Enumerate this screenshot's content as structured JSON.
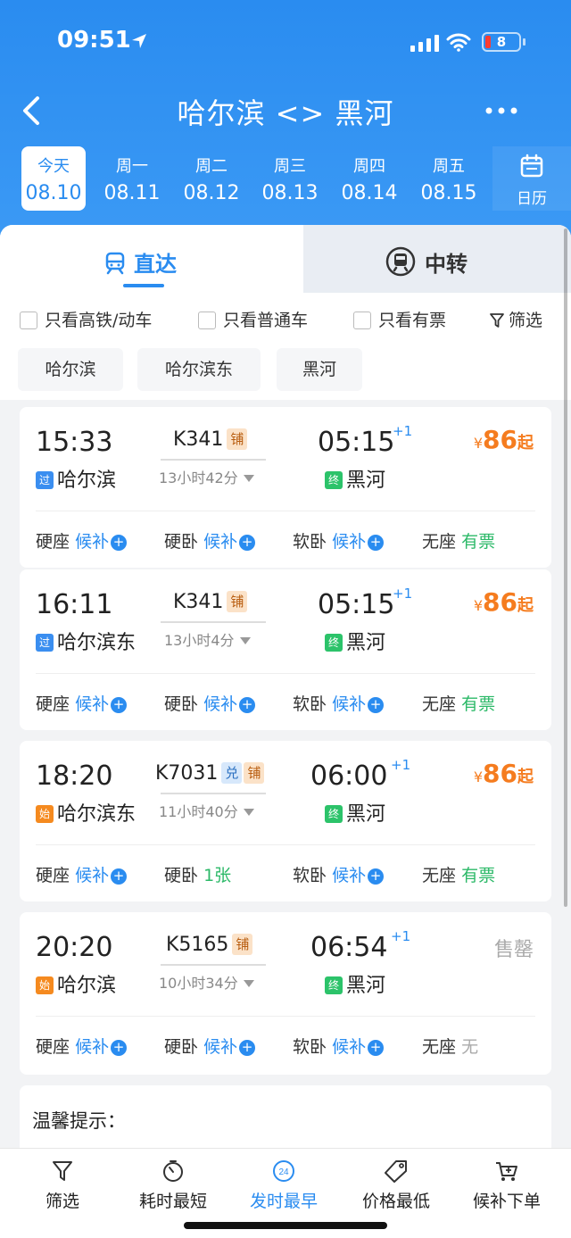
{
  "status": {
    "time": "09:51",
    "battery": "8"
  },
  "nav": {
    "title": "哈尔滨 <> 黑河"
  },
  "dates": [
    {
      "weekday": "今天",
      "date": "08.10",
      "active": true
    },
    {
      "weekday": "周一",
      "date": "08.11"
    },
    {
      "weekday": "周二",
      "date": "08.12"
    },
    {
      "weekday": "周三",
      "date": "08.13"
    },
    {
      "weekday": "周四",
      "date": "08.14"
    },
    {
      "weekday": "周五",
      "date": "08.15"
    }
  ],
  "calendar_label": "日历",
  "tabs": {
    "direct": "直达",
    "transfer": "中转"
  },
  "filters": {
    "high_speed": "只看高铁/动车",
    "normal": "只看普通车",
    "available": "只看有票",
    "filter": "筛选"
  },
  "stations": [
    "哈尔滨",
    "哈尔滨东",
    "黑河"
  ],
  "trains": [
    {
      "dep_time": "15:33",
      "dep_station": "哈尔滨",
      "dep_tag": "过",
      "number": "K341",
      "badges": [
        "铺"
      ],
      "duration": "13小时42分",
      "arr_time": "05:15",
      "arr_plus": "+1",
      "arr_station": "黑河",
      "arr_tag": "终",
      "price_symbol": "¥",
      "price": "86",
      "price_suffix": "起",
      "seats": [
        {
          "name": "硬座",
          "status": "候补"
        },
        {
          "name": "硬卧",
          "status": "候补"
        },
        {
          "name": "软卧",
          "status": "候补"
        },
        {
          "name": "无座",
          "status": "有票"
        }
      ]
    },
    {
      "dep_time": "16:11",
      "dep_station": "哈尔滨东",
      "dep_tag": "过",
      "number": "K341",
      "badges": [
        "铺"
      ],
      "duration": "13小时4分",
      "arr_time": "05:15",
      "arr_plus": "+1",
      "arr_station": "黑河",
      "arr_tag": "终",
      "price_symbol": "¥",
      "price": "86",
      "price_suffix": "起",
      "seats": [
        {
          "name": "硬座",
          "status": "候补"
        },
        {
          "name": "硬卧",
          "status": "候补"
        },
        {
          "name": "软卧",
          "status": "候补"
        },
        {
          "name": "无座",
          "status": "有票"
        }
      ]
    },
    {
      "dep_time": "18:20",
      "dep_station": "哈尔滨东",
      "dep_tag": "始",
      "number": "K7031",
      "badges": [
        "兑",
        "铺"
      ],
      "duration": "11小时40分",
      "arr_time": "06:00",
      "arr_plus": "+1",
      "arr_station": "黑河",
      "arr_tag": "终",
      "price_symbol": "¥",
      "price": "86",
      "price_suffix": "起",
      "seats": [
        {
          "name": "硬座",
          "status": "候补"
        },
        {
          "name": "硬卧",
          "status": "1张"
        },
        {
          "name": "软卧",
          "status": "候补"
        },
        {
          "name": "无座",
          "status": "有票"
        }
      ]
    },
    {
      "dep_time": "20:20",
      "dep_station": "哈尔滨",
      "dep_tag": "始",
      "number": "K5165",
      "badges": [
        "铺"
      ],
      "duration": "10小时34分",
      "arr_time": "06:54",
      "arr_plus": "+1",
      "arr_station": "黑河",
      "arr_tag": "终",
      "soldout": "售罄",
      "seats": [
        {
          "name": "硬座",
          "status": "候补"
        },
        {
          "name": "硬卧",
          "status": "候补"
        },
        {
          "name": "软卧",
          "status": "候补"
        },
        {
          "name": "无座",
          "status": "无"
        }
      ]
    }
  ],
  "tips_title": "温馨提示：",
  "bottom_tabs": [
    {
      "label": "筛选",
      "icon": "funnel-icon"
    },
    {
      "label": "耗时最短",
      "icon": "stopwatch-icon"
    },
    {
      "label": "发时最早",
      "icon": "clock-24-icon",
      "icon_text": "24",
      "active": true
    },
    {
      "label": "价格最低",
      "icon": "price-tag-icon"
    },
    {
      "label": "候补下单",
      "icon": "cart-plus-icon"
    }
  ],
  "colors": {
    "primary": "#2a8cf0",
    "price": "#f57c1f",
    "available": "#2cb968"
  }
}
